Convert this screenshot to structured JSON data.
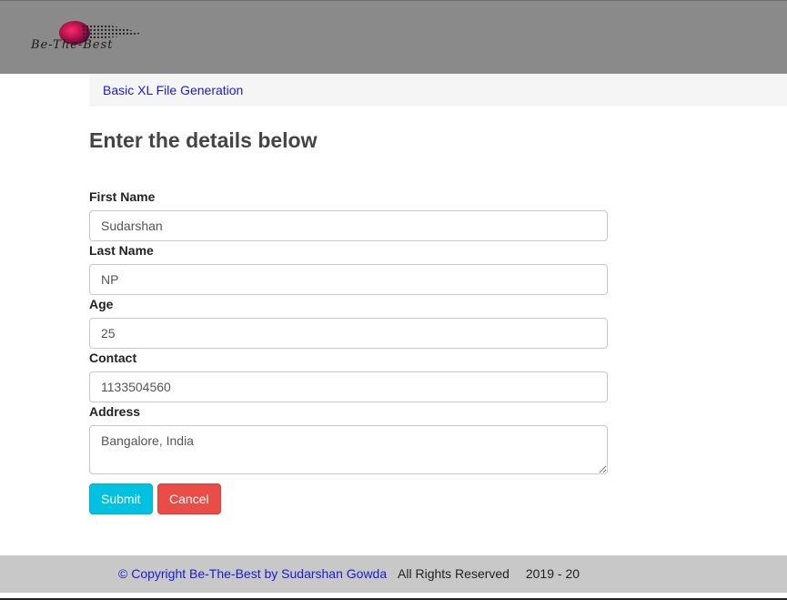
{
  "header": {
    "logo_text": "Be-The-Best"
  },
  "breadcrumb": {
    "link": "Basic XL File Generation"
  },
  "page": {
    "title": "Enter the details below"
  },
  "form": {
    "first_name": {
      "label": "First Name",
      "value": "Sudarshan"
    },
    "last_name": {
      "label": "Last Name",
      "value": "NP"
    },
    "age": {
      "label": "Age",
      "value": "25"
    },
    "contact": {
      "label": "Contact",
      "value": "1133504560"
    },
    "address": {
      "label": "Address",
      "value": "Bangalore, India"
    }
  },
  "buttons": {
    "submit": "Submit",
    "cancel": "Cancel"
  },
  "footer": {
    "copyright": "© Copyright Be-The-Best by Sudarshan Gowda",
    "rights": "All Rights Reserved",
    "year": "2019 - 20"
  },
  "colors": {
    "header_bg": "#8a8a8a",
    "link": "#1a1ad6",
    "submit": "#00c1e0",
    "cancel": "#ea4d47",
    "footer_bg": "#c8c8c8"
  }
}
